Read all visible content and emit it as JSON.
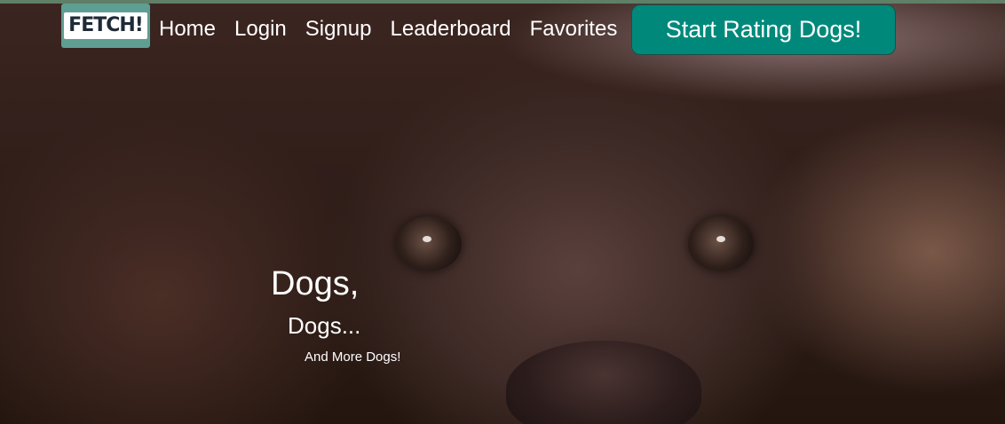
{
  "brand": {
    "logo_text": "FETCH!",
    "logo_bg": "#5f9e93"
  },
  "nav": {
    "items": [
      {
        "label": "Home"
      },
      {
        "label": "Login"
      },
      {
        "label": "Signup"
      },
      {
        "label": "Leaderboard"
      },
      {
        "label": "Favorites"
      }
    ],
    "cta_label": "Start Rating Dogs!",
    "cta_color": "#00897b"
  },
  "hero": {
    "line1": "Dogs,",
    "line2": "Dogs...",
    "line3": "And More Dogs!"
  }
}
